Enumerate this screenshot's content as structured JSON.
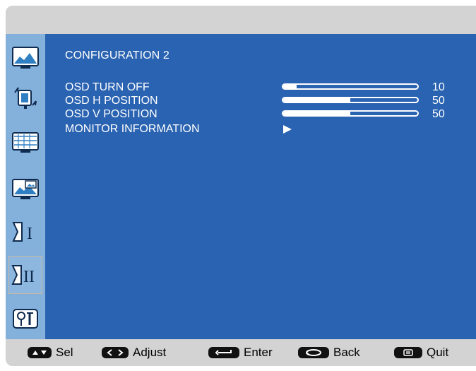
{
  "menu": {
    "title": "CONFIGURATION 2",
    "items": [
      {
        "label": "OSD TURN OFF",
        "value": "10",
        "level": 10
      },
      {
        "label": "OSD H POSITION",
        "value": "50",
        "level": 50
      },
      {
        "label": "OSD V POSITION",
        "value": "50",
        "level": 50
      },
      {
        "label": "MONITOR INFORMATION",
        "submenu": true
      }
    ]
  },
  "sidebar": {
    "items": [
      {
        "name": "picture",
        "icon": "picture-icon"
      },
      {
        "name": "adjust",
        "icon": "monitor-adjust-icon"
      },
      {
        "name": "geometry",
        "icon": "geometry-icon"
      },
      {
        "name": "pip",
        "icon": "pip-icon"
      },
      {
        "name": "configuration-1",
        "icon": "configuration-1-icon"
      },
      {
        "name": "configuration-2",
        "icon": "configuration-2-icon",
        "active": true
      },
      {
        "name": "tools",
        "icon": "tools-icon"
      }
    ]
  },
  "footer": {
    "sel": "Sel",
    "adjust": "Adjust",
    "enter": "Enter",
    "back": "Back",
    "quit": "Quit"
  },
  "colors": {
    "panel": "#2a63b1",
    "sidebar": "#84b1dc",
    "frame": "#d3d3d3",
    "text": "#ffffff"
  }
}
